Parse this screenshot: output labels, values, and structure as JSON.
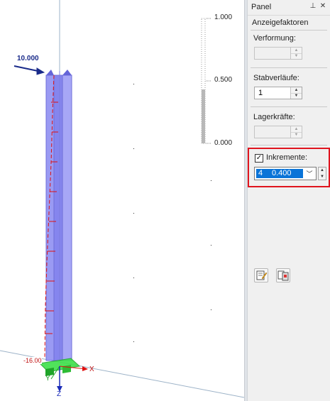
{
  "viewport": {
    "load_label": "10.000",
    "support_value": "-16.00",
    "axis_x": "X",
    "axis_y": "Y",
    "axis_z": "Z",
    "scale_labels": [
      "1.000",
      "0.500",
      "0.000"
    ],
    "member_color": "#8a8af0",
    "support_color": "#3ee04a",
    "axis_color": "#e01010",
    "z_axis_color": "#1a2bb8"
  },
  "panel": {
    "title": "Panel",
    "pin_icon": "pin-icon",
    "close_icon": "close-icon",
    "section": "Anzeigefaktoren",
    "verformung": {
      "label": "Verformung:",
      "value": "",
      "enabled": false
    },
    "stabverlaeufe": {
      "label": "Stabverläufe:",
      "value": "1",
      "enabled": true
    },
    "lagerkraefte": {
      "label": "Lagerkräfte:",
      "value": "",
      "enabled": false
    },
    "inkremente": {
      "label": "Inkremente:",
      "checked": true,
      "index": "4",
      "value": "0.400",
      "highlight_color": "#e0141e"
    },
    "tool_buttons": [
      "edit-icon",
      "copy-icon"
    ]
  }
}
